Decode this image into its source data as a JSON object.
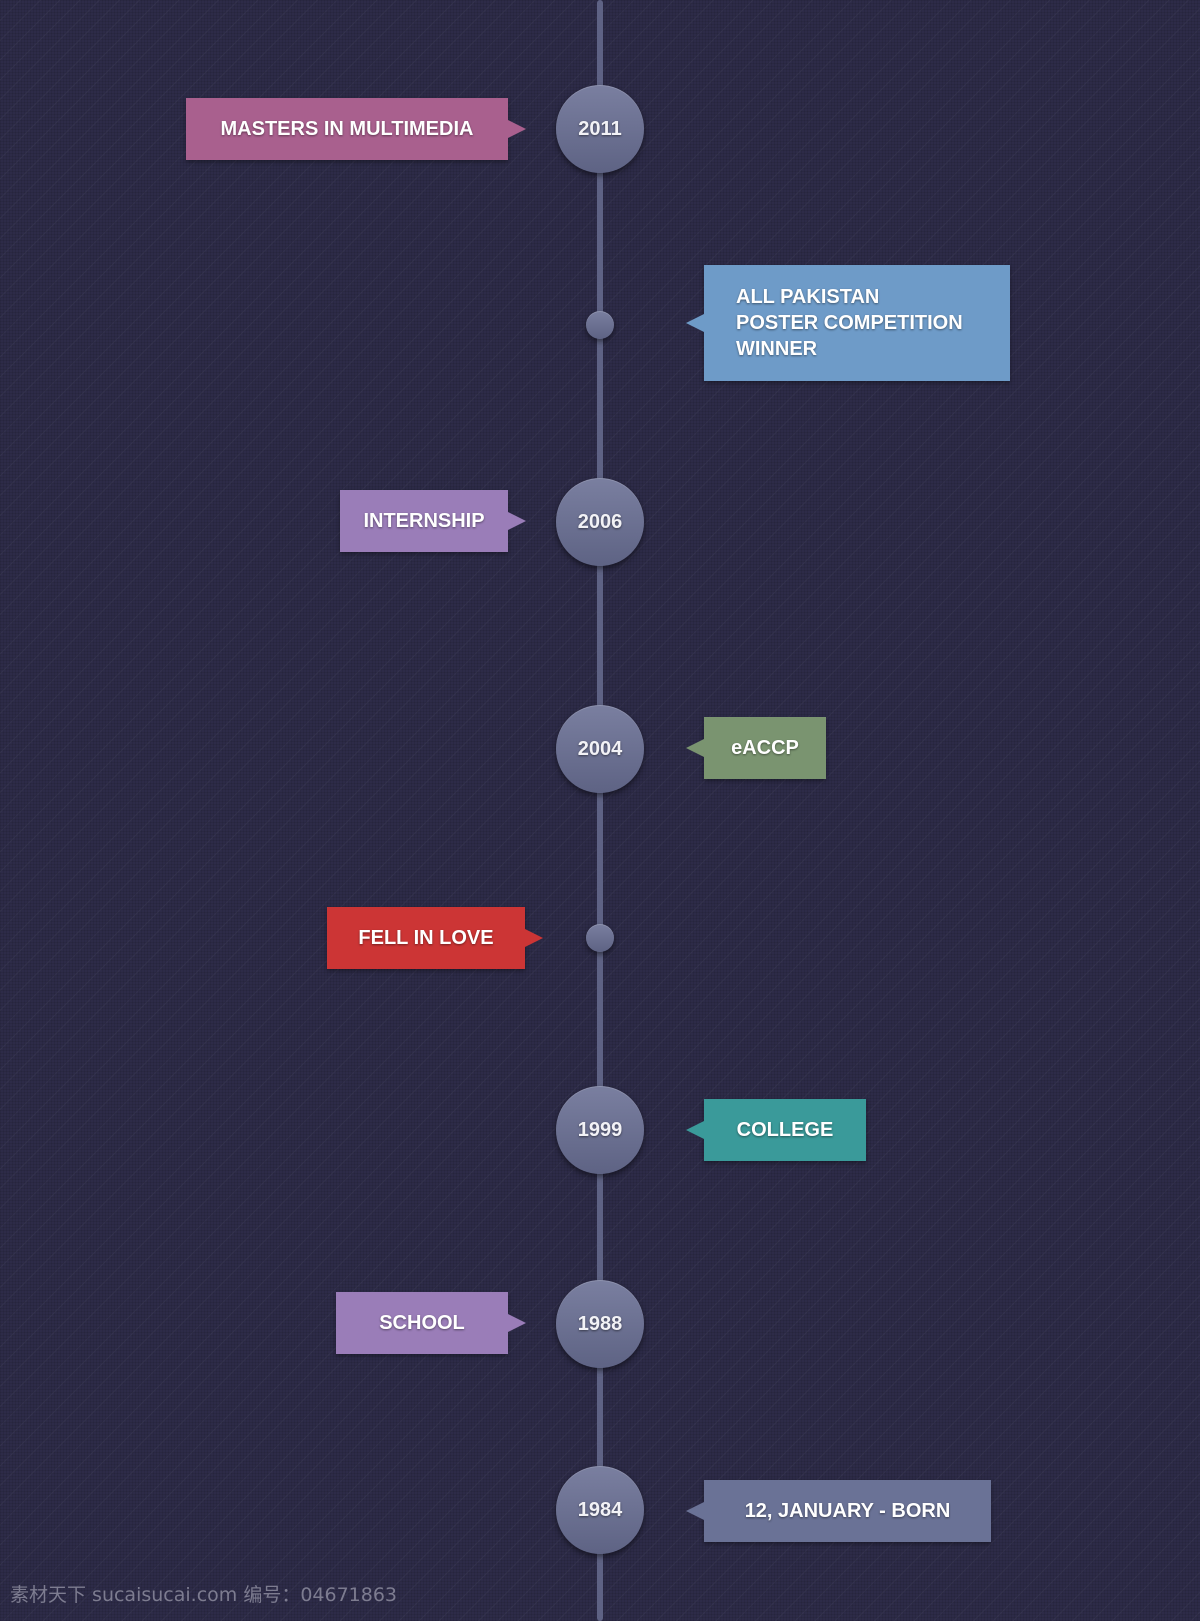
{
  "timeline": {
    "events": [
      {
        "year": "2011",
        "label": "MASTERS IN MULTIMEDIA",
        "side": "left",
        "color": "#a9608e"
      },
      {
        "year": "",
        "label": "ALL PAKISTAN\nPOSTER COMPETITION\nWINNER",
        "side": "right",
        "color": "#6e9bc8"
      },
      {
        "year": "2006",
        "label": "INTERNSHIP",
        "side": "left",
        "color": "#9a7db8"
      },
      {
        "year": "2004",
        "label": "eACCP",
        "side": "right",
        "color": "#7a9470"
      },
      {
        "year": "",
        "label": "FELL IN LOVE",
        "side": "left",
        "color": "#cc3535"
      },
      {
        "year": "1999",
        "label": "COLLEGE",
        "side": "right",
        "color": "#3a9a9a"
      },
      {
        "year": "1988",
        "label": "SCHOOL",
        "side": "left",
        "color": "#9a7db8"
      },
      {
        "year": "1984",
        "label": "12, JANUARY - BORN",
        "side": "right",
        "color": "#6a7296"
      }
    ]
  },
  "watermark": "素材天下 sucaisucai.com  编号：04671863"
}
